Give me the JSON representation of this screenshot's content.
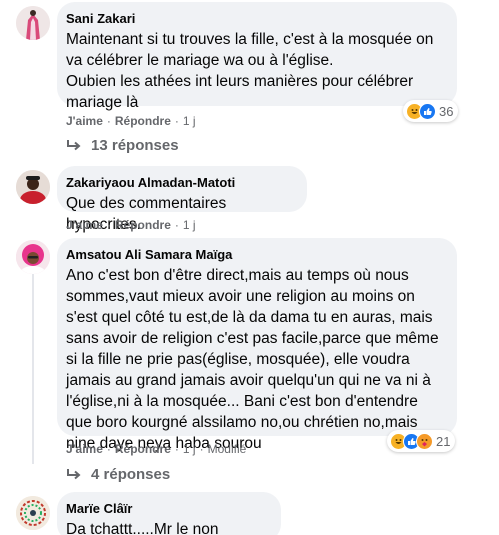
{
  "comments": [
    {
      "author": "Sani Zakari",
      "text": "Maintenant si tu trouves la fille, c'est à la mosquée on va célébrer le mariage wa ou à l'église.\nOubien les athées int leurs manières pour célébrer mariage là",
      "like_label": "J'aime",
      "reply_label": "Répondre",
      "time": "1 j",
      "reaction_count": "36",
      "replies_label": "13 réponses"
    },
    {
      "author": "Zakariyaou Almadan-Matoti",
      "text": "Que des commentaires hypocrites.",
      "like_label": "J'aime",
      "reply_label": "Répondre",
      "time": "1 j"
    },
    {
      "author": "Amsatou Ali Samara Maïga",
      "text": "Ano c'est bon d'être direct,mais au temps où nous sommes,vaut mieux avoir une religion au moins on s'est quel côté tu est,de là da dama tu en auras, mais sans avoir de religion c'est pas facile,parce que même si la fille ne prie pas(église, mosquée), elle voudra jamais au grand jamais avoir quelqu'un qui ne va ni à l'église,ni à la mosquée... Bani c'est bon d'entendre que boro kourgné alssilamo no,ou chrétien no,mais nine daye neya haba sourou",
      "like_label": "J'aime",
      "reply_label": "Répondre",
      "time": "1 j",
      "modified_label": "Modifié",
      "reaction_count": "21",
      "replies_label": "4 réponses"
    },
    {
      "author": "Marïe Clâïr",
      "text": "Da tchattt.....Mr le non croyant"
    }
  ],
  "colors": {
    "bubble": "#f0f2f5",
    "meta": "#65676b",
    "like_blue": "#1877f2",
    "haha_yellow": "#f7b125",
    "care_orange": "#f59a28"
  }
}
